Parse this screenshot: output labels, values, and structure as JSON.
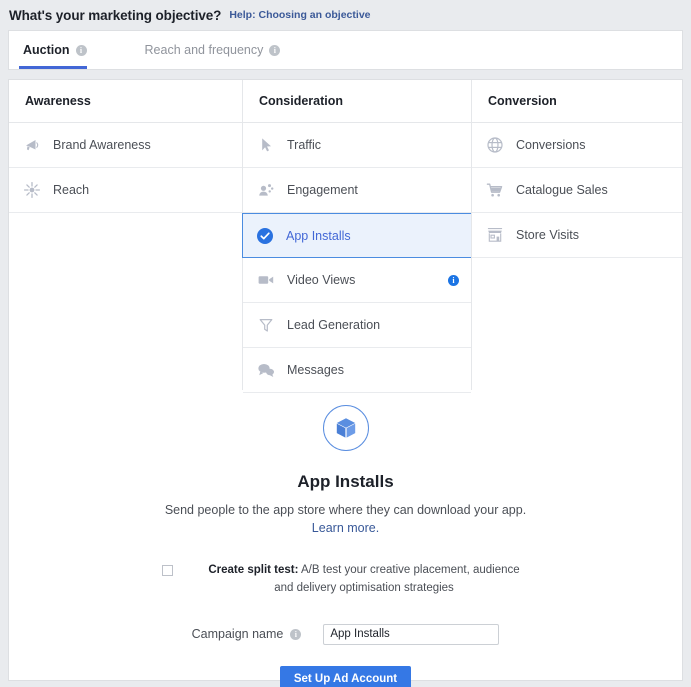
{
  "header": {
    "title": "What's your marketing objective?",
    "help_label": "Help: Choosing an objective"
  },
  "tabs": [
    {
      "label": "Auction",
      "active": true,
      "info_icon": "info-icon"
    },
    {
      "label": "Reach and frequency",
      "active": false,
      "info_icon": "info-icon"
    }
  ],
  "columns": [
    {
      "header": "Awareness",
      "items": [
        {
          "label": "Brand Awareness",
          "icon": "megaphone-icon",
          "selected": false,
          "info": false
        },
        {
          "label": "Reach",
          "icon": "reach-burst-icon",
          "selected": false,
          "info": false
        }
      ]
    },
    {
      "header": "Consideration",
      "items": [
        {
          "label": "Traffic",
          "icon": "cursor-arrow-icon",
          "selected": false,
          "info": false
        },
        {
          "label": "Engagement",
          "icon": "people-icon",
          "selected": false,
          "info": false
        },
        {
          "label": "App Installs",
          "icon": "check-circle-icon",
          "selected": true,
          "info": false
        },
        {
          "label": "Video Views",
          "icon": "video-camera-icon",
          "selected": false,
          "info": true
        },
        {
          "label": "Lead Generation",
          "icon": "funnel-icon",
          "selected": false,
          "info": false
        },
        {
          "label": "Messages",
          "icon": "speech-bubbles-icon",
          "selected": false,
          "info": false
        }
      ]
    },
    {
      "header": "Conversion",
      "items": [
        {
          "label": "Conversions",
          "icon": "globe-icon",
          "selected": false,
          "info": false
        },
        {
          "label": "Catalogue Sales",
          "icon": "shopping-cart-icon",
          "selected": false,
          "info": false
        },
        {
          "label": "Store Visits",
          "icon": "storefront-icon",
          "selected": false,
          "info": false
        }
      ]
    }
  ],
  "detail": {
    "badge_icon": "cube-icon",
    "title": "App Installs",
    "description": "Send people to the app store where they can download your app.",
    "learn_more": "Learn more."
  },
  "split_test": {
    "checked": false,
    "label": "Create split test:",
    "description": "A/B test your creative placement, audience and delivery optimisation strategies"
  },
  "campaign": {
    "label": "Campaign name",
    "info_icon": "info-icon",
    "value": "App Installs",
    "placeholder": "Campaign name"
  },
  "cta": {
    "label": "Set Up Ad Account"
  },
  "colors": {
    "accent": "#3578e5",
    "link": "#385898",
    "selected_bg": "#ebf2fc",
    "selected_border": "#4b8ce0",
    "page_bg": "#e9ebee",
    "icon_grey": "#b7bcc8"
  }
}
